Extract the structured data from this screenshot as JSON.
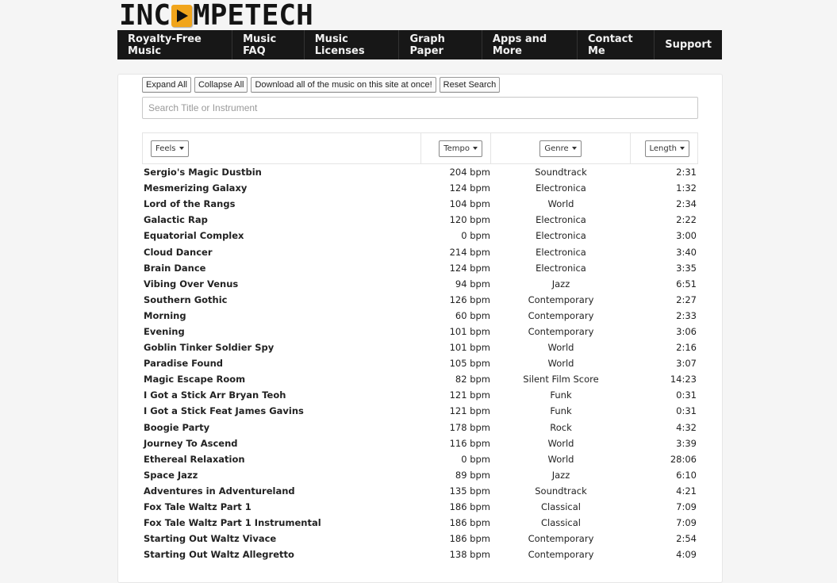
{
  "logo": {
    "text_before": "INC",
    "text_after": "MPETECH",
    "icon": "play-icon",
    "accent": "#f1a51c"
  },
  "nav": {
    "items": [
      {
        "label": "Royalty-Free Music"
      },
      {
        "label": "Music FAQ"
      },
      {
        "label": "Music Licenses"
      },
      {
        "label": "Graph Paper"
      },
      {
        "label": "Apps and More"
      },
      {
        "label": "Contact Me"
      },
      {
        "label": "Support"
      }
    ]
  },
  "toolbar": {
    "expand_all": "Expand All",
    "collapse_all": "Collapse All",
    "download_all": "Download all of the music on this site at once!",
    "reset_search": "Reset Search"
  },
  "search": {
    "placeholder": "Search Title or Instrument",
    "value": ""
  },
  "table": {
    "headers": {
      "feels": "Feels",
      "tempo": "Tempo",
      "genre": "Genre",
      "length": "Length"
    },
    "rows": [
      {
        "title": "Sergio's Magic Dustbin",
        "tempo": "204 bpm",
        "genre": "Soundtrack",
        "length": "2:31"
      },
      {
        "title": "Mesmerizing Galaxy",
        "tempo": "124 bpm",
        "genre": "Electronica",
        "length": "1:32"
      },
      {
        "title": "Lord of the Rangs",
        "tempo": "104 bpm",
        "genre": "World",
        "length": "2:34"
      },
      {
        "title": "Galactic Rap",
        "tempo": "120 bpm",
        "genre": "Electronica",
        "length": "2:22"
      },
      {
        "title": "Equatorial Complex",
        "tempo": "0 bpm",
        "genre": "Electronica",
        "length": "3:00"
      },
      {
        "title": "Cloud Dancer",
        "tempo": "214 bpm",
        "genre": "Electronica",
        "length": "3:40"
      },
      {
        "title": "Brain Dance",
        "tempo": "124 bpm",
        "genre": "Electronica",
        "length": "3:35"
      },
      {
        "title": "Vibing Over Venus",
        "tempo": "94 bpm",
        "genre": "Jazz",
        "length": "6:51"
      },
      {
        "title": "Southern Gothic",
        "tempo": "126 bpm",
        "genre": "Contemporary",
        "length": "2:27"
      },
      {
        "title": "Morning",
        "tempo": "60 bpm",
        "genre": "Contemporary",
        "length": "2:33"
      },
      {
        "title": "Evening",
        "tempo": "101 bpm",
        "genre": "Contemporary",
        "length": "3:06"
      },
      {
        "title": "Goblin Tinker Soldier Spy",
        "tempo": "101 bpm",
        "genre": "World",
        "length": "2:16"
      },
      {
        "title": "Paradise Found",
        "tempo": "105 bpm",
        "genre": "World",
        "length": "3:07"
      },
      {
        "title": "Magic Escape Room",
        "tempo": "82 bpm",
        "genre": "Silent Film Score",
        "length": "14:23"
      },
      {
        "title": "I Got a Stick Arr Bryan Teoh",
        "tempo": "121 bpm",
        "genre": "Funk",
        "length": "0:31"
      },
      {
        "title": "I Got a Stick Feat James Gavins",
        "tempo": "121 bpm",
        "genre": "Funk",
        "length": "0:31"
      },
      {
        "title": "Boogie Party",
        "tempo": "178 bpm",
        "genre": "Rock",
        "length": "4:32"
      },
      {
        "title": "Journey To Ascend",
        "tempo": "116 bpm",
        "genre": "World",
        "length": "3:39"
      },
      {
        "title": "Ethereal Relaxation",
        "tempo": "0 bpm",
        "genre": "World",
        "length": "28:06"
      },
      {
        "title": "Space Jazz",
        "tempo": "89 bpm",
        "genre": "Jazz",
        "length": "6:10"
      },
      {
        "title": "Adventures in Adventureland",
        "tempo": "135 bpm",
        "genre": "Soundtrack",
        "length": "4:21"
      },
      {
        "title": "Fox Tale Waltz Part 1",
        "tempo": "186 bpm",
        "genre": "Classical",
        "length": "7:09"
      },
      {
        "title": "Fox Tale Waltz Part 1 Instrumental",
        "tempo": "186 bpm",
        "genre": "Classical",
        "length": "7:09"
      },
      {
        "title": "Starting Out Waltz Vivace",
        "tempo": "186 bpm",
        "genre": "Contemporary",
        "length": "2:54"
      },
      {
        "title": "Starting Out Waltz Allegretto",
        "tempo": "138 bpm",
        "genre": "Contemporary",
        "length": "4:09"
      }
    ]
  }
}
